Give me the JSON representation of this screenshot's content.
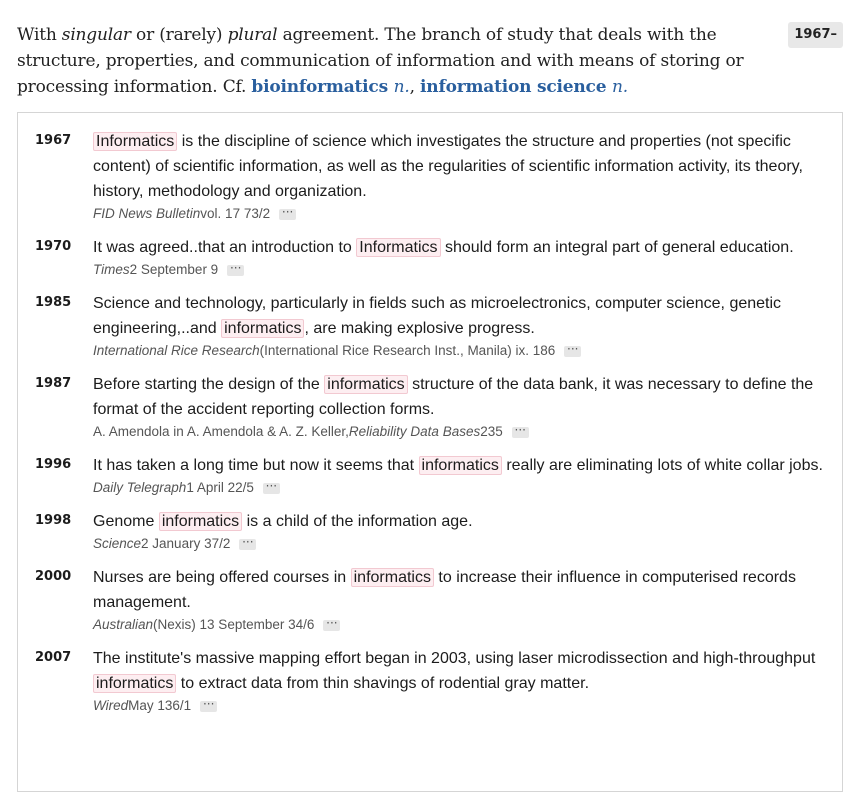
{
  "definition": {
    "t1": "With ",
    "t2": "singular",
    "t3": " or (rarely) ",
    "t4": "plural",
    "t5": " agreement. The branch of study that deals with the structure, properties, and communication of information and with means of storing or processing information. Cf. ",
    "xref1": "bioinformatics",
    "xref1_pos": "n.",
    "sep": ", ",
    "xref2": "information science",
    "xref2_pos": "n."
  },
  "date_range": "1967–",
  "more_glyph": "···",
  "quotations": [
    {
      "year": "1967",
      "pre": "",
      "term": "Informatics",
      "post": " is the discipline of science which investigates the structure and properties (not specific content) of scientific information, as well as the regularities of scientific information activity, its theory, history, methodology and organization.",
      "src_pre": "",
      "src_italic": "FID News Bulletin",
      "src_post": " vol. 17 73/2"
    },
    {
      "year": "1970",
      "pre": "It was agreed..that an introduction to ",
      "term": "Informatics",
      "post": " should form an integral part of general education.",
      "src_pre": "",
      "src_italic": "Times",
      "src_post": " 2 September 9"
    },
    {
      "year": "1985",
      "pre": "Science and technology, particularly in fields such as microelectronics, computer science, genetic engineering,..and ",
      "term": "informatics",
      "post": ", are making explosive progress.",
      "src_pre": "",
      "src_italic": "International Rice Research",
      "src_post": " (International Rice Research Inst., Manila) ix. 186"
    },
    {
      "year": "1987",
      "pre": "Before starting the design of the ",
      "term": "informatics",
      "post": " structure of the data bank, it was necessary to define the format of the accident reporting collection forms.",
      "src_pre": "A. Amendola in A. Amendola & A. Z. Keller, ",
      "src_italic": "Reliability Data Bases",
      "src_post": " 235"
    },
    {
      "year": "1996",
      "pre": "It has taken a long time but now it seems that ",
      "term": "informatics",
      "post": " really are eliminating lots of white collar jobs.",
      "src_pre": "",
      "src_italic": "Daily Telegraph",
      "src_post": " 1 April 22/5"
    },
    {
      "year": "1998",
      "pre": "Genome ",
      "term": "informatics",
      "post": " is a child of the information age.",
      "src_pre": "",
      "src_italic": "Science",
      "src_post": " 2 January 37/2"
    },
    {
      "year": "2000",
      "pre": "Nurses are being offered courses in ",
      "term": "informatics",
      "post": " to increase their influence in computerised records management.",
      "src_pre": "",
      "src_italic": "Australian",
      "src_post": " (Nexis) 13 September 34/6"
    },
    {
      "year": "2007",
      "pre": "The institute's massive mapping effort began in 2003, using laser microdissection and high-throughput ",
      "term": "informatics",
      "post": " to extract data from thin shavings of rodential gray matter.",
      "src_pre": "",
      "src_italic": "Wired",
      "src_post": " May 136/1"
    }
  ]
}
